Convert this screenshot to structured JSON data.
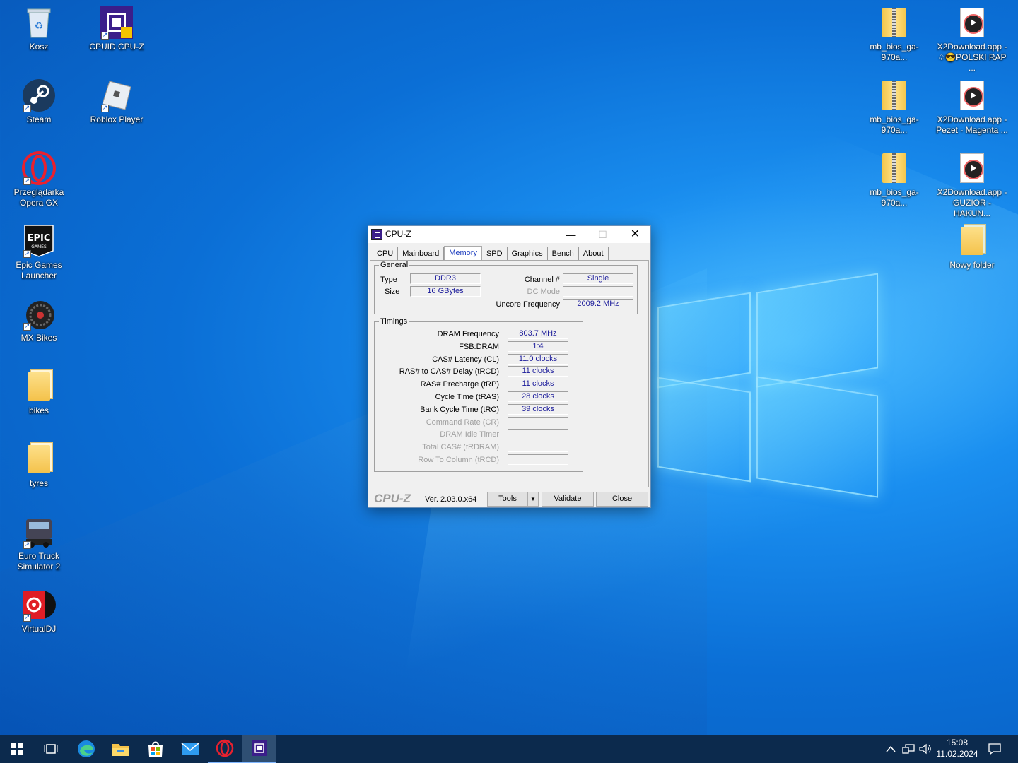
{
  "desktop": {
    "left_icons": [
      {
        "label": "Kosz",
        "icon": "recycle-bin-icon"
      },
      {
        "label": "CPUID CPU-Z",
        "icon": "cpuz-icon"
      },
      {
        "label": "Steam",
        "icon": "steam-icon"
      },
      {
        "label": "Roblox Player",
        "icon": "roblox-icon"
      },
      {
        "label": "Przeglądarka Opera GX",
        "icon": "opera-gx-icon"
      },
      {
        "label": "Epic Games Launcher",
        "icon": "epic-games-icon"
      },
      {
        "label": "MX Bikes",
        "icon": "mx-bikes-icon"
      },
      {
        "label": "bikes",
        "icon": "folder-icon"
      },
      {
        "label": "tyres",
        "icon": "folder-icon"
      },
      {
        "label": "Euro Truck Simulator 2",
        "icon": "ets2-icon"
      },
      {
        "label": "VirtualDJ",
        "icon": "virtualdj-icon"
      }
    ],
    "right_icons": [
      {
        "label": "mb_bios_ga-970a...",
        "icon": "zip-icon"
      },
      {
        "label": "X2Download.app - ♤😎POLSKI RAP ...",
        "icon": "media-file-icon"
      },
      {
        "label": "mb_bios_ga-970a...",
        "icon": "zip-icon"
      },
      {
        "label": "X2Download.app - Pezet - Magenta ...",
        "icon": "media-file-icon"
      },
      {
        "label": "mb_bios_ga-970a...",
        "icon": "zip-icon"
      },
      {
        "label": "X2Download.app - GUZIOR - HAKUN...",
        "icon": "media-file-icon"
      },
      {
        "label": "Nowy folder",
        "icon": "folder-icon"
      }
    ]
  },
  "cpuz": {
    "title": "CPU-Z",
    "tabs": [
      "CPU",
      "Mainboard",
      "Memory",
      "SPD",
      "Graphics",
      "Bench",
      "About"
    ],
    "active_tab": "Memory",
    "general": {
      "group_title": "General",
      "type_label": "Type",
      "type_value": "DDR3",
      "size_label": "Size",
      "size_value": "16 GBytes",
      "channel_label": "Channel #",
      "channel_value": "Single",
      "dcmode_label": "DC Mode",
      "dcmode_value": "",
      "uncore_label": "Uncore Frequency",
      "uncore_value": "2009.2 MHz"
    },
    "timings": {
      "group_title": "Timings",
      "rows": [
        {
          "label": "DRAM Frequency",
          "value": "803.7 MHz",
          "enabled": true
        },
        {
          "label": "FSB:DRAM",
          "value": "1:4",
          "enabled": true
        },
        {
          "label": "CAS# Latency (CL)",
          "value": "11.0 clocks",
          "enabled": true
        },
        {
          "label": "RAS# to CAS# Delay (tRCD)",
          "value": "11 clocks",
          "enabled": true
        },
        {
          "label": "RAS# Precharge (tRP)",
          "value": "11 clocks",
          "enabled": true
        },
        {
          "label": "Cycle Time (tRAS)",
          "value": "28 clocks",
          "enabled": true
        },
        {
          "label": "Bank Cycle Time (tRC)",
          "value": "39 clocks",
          "enabled": true
        },
        {
          "label": "Command Rate (CR)",
          "value": "",
          "enabled": false
        },
        {
          "label": "DRAM Idle Timer",
          "value": "",
          "enabled": false
        },
        {
          "label": "Total CAS# (tRDRAM)",
          "value": "",
          "enabled": false
        },
        {
          "label": "Row To Column (tRCD)",
          "value": "",
          "enabled": false
        }
      ]
    },
    "footer": {
      "brand": "CPU-Z",
      "version": "Ver. 2.03.0.x64",
      "tools_label": "Tools",
      "validate_label": "Validate",
      "close_label": "Close"
    }
  },
  "taskbar": {
    "apps": [
      "start-icon",
      "task-view-icon",
      "edge-icon",
      "file-explorer-icon",
      "store-icon",
      "mail-icon",
      "opera-gx-icon",
      "cpuz-icon"
    ],
    "time": "15:08",
    "date": "11.02.2024"
  }
}
